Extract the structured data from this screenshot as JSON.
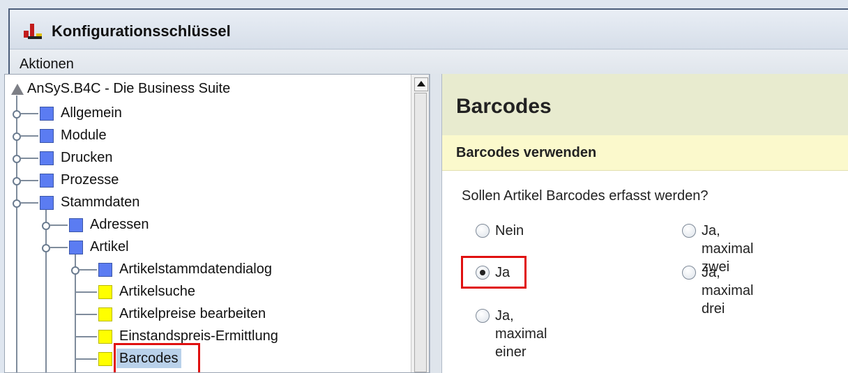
{
  "window": {
    "title": "Konfigurationsschlüssel"
  },
  "menubar": {
    "items": [
      "Aktionen"
    ]
  },
  "tree": {
    "root": "AnSyS.B4C - Die Business Suite",
    "items": [
      {
        "label": "Allgemein"
      },
      {
        "label": "Module"
      },
      {
        "label": "Drucken"
      },
      {
        "label": "Prozesse"
      },
      {
        "label": "Stammdaten"
      },
      {
        "label": "Adressen"
      },
      {
        "label": "Artikel"
      },
      {
        "label": "Artikelstammdatendialog"
      },
      {
        "label": "Artikelsuche"
      },
      {
        "label": "Artikelpreise bearbeiten"
      },
      {
        "label": "Einstandspreis-Ermittlung"
      },
      {
        "label": "Barcodes"
      }
    ]
  },
  "panel": {
    "title": "Barcodes",
    "section": "Barcodes verwenden",
    "question": "Sollen Artikel Barcodes erfasst werden?",
    "options": [
      "Nein",
      "Ja, maximal zwei",
      "Ja",
      "Ja, maximal drei",
      "Ja, maximal einer"
    ],
    "selected": "Ja"
  },
  "colors": {
    "highlight_box": "#e01010",
    "header_bg": "#e8ebcf",
    "subheader_bg": "#fbf9cc"
  }
}
